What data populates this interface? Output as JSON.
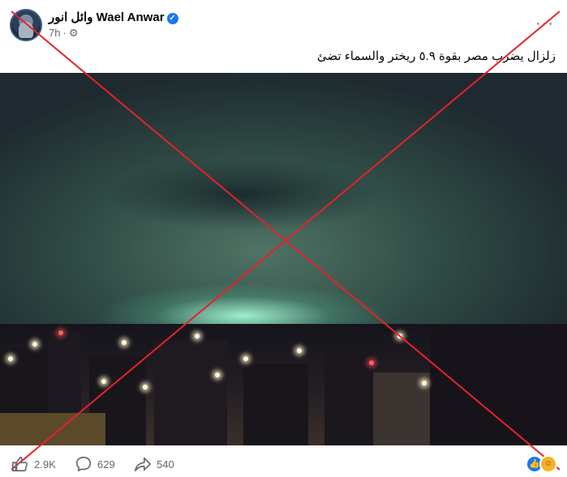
{
  "post": {
    "author": "وائل انور Wael Anwar",
    "time": "7h",
    "caption": "زلزال يضرب مصر  بقوة ٥.٩ ريختر والسماء تضئ"
  },
  "engagement": {
    "likes": "2.9K",
    "comments": "629",
    "shares": "540"
  },
  "icons": {
    "verified": "verified-badge-icon",
    "audience": "gear-icon",
    "more": "more-options-icon",
    "like": "thumbs-up-icon",
    "comment": "comment-bubble-icon",
    "share": "share-arrow-icon"
  },
  "colors": {
    "cross": "#e8202a",
    "brand": "#1877f2",
    "secondary_text": "#65676b"
  }
}
